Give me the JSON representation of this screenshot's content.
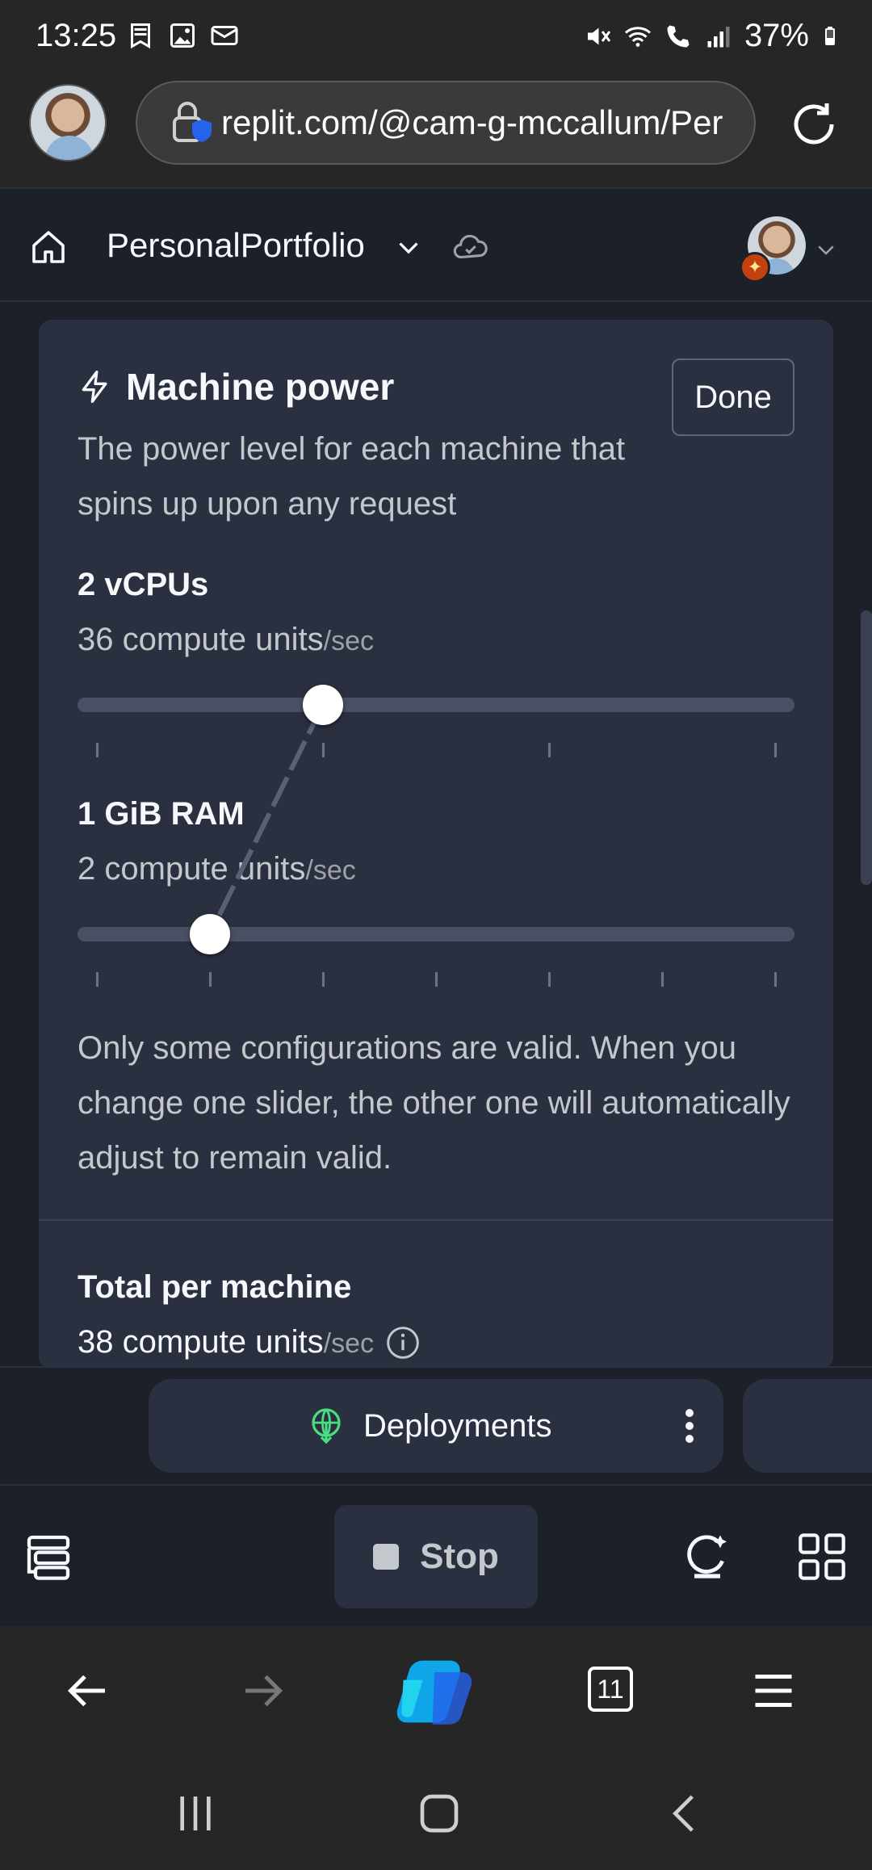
{
  "status_bar": {
    "time": "13:25",
    "battery": "37%",
    "icons": [
      "bookmark-notification-icon",
      "image-notification-icon",
      "mail-notification-icon",
      "mute-icon",
      "wifi-icon",
      "wifi-calling-icon",
      "signal-icon",
      "battery-icon"
    ]
  },
  "browser": {
    "url": "replit.com/@cam-g-mccallum/Per"
  },
  "header": {
    "project_name": "PersonalPortfolio"
  },
  "machine_power": {
    "title": "Machine power",
    "done_label": "Done",
    "description": "The power level for each machine that spins up upon any request",
    "cpu": {
      "label": "2 vCPUs",
      "units": "36 compute units",
      "per": "/sec",
      "slider_ticks": 4,
      "slider_index": 1
    },
    "ram": {
      "label": "1 GiB RAM",
      "units": "2 compute units",
      "per": "/sec",
      "slider_ticks": 7,
      "slider_index": 1
    },
    "note": "Only some configurations are valid. When you change one slider, the other one will automatically adjust to remain valid.",
    "total_label": "Total per machine",
    "total_units": "38 compute units",
    "total_per": "/sec"
  },
  "tabstrip": {
    "active_tab": "Deployments"
  },
  "toolbar": {
    "stop_label": "Stop"
  },
  "browser_nav": {
    "tab_count": "11"
  }
}
